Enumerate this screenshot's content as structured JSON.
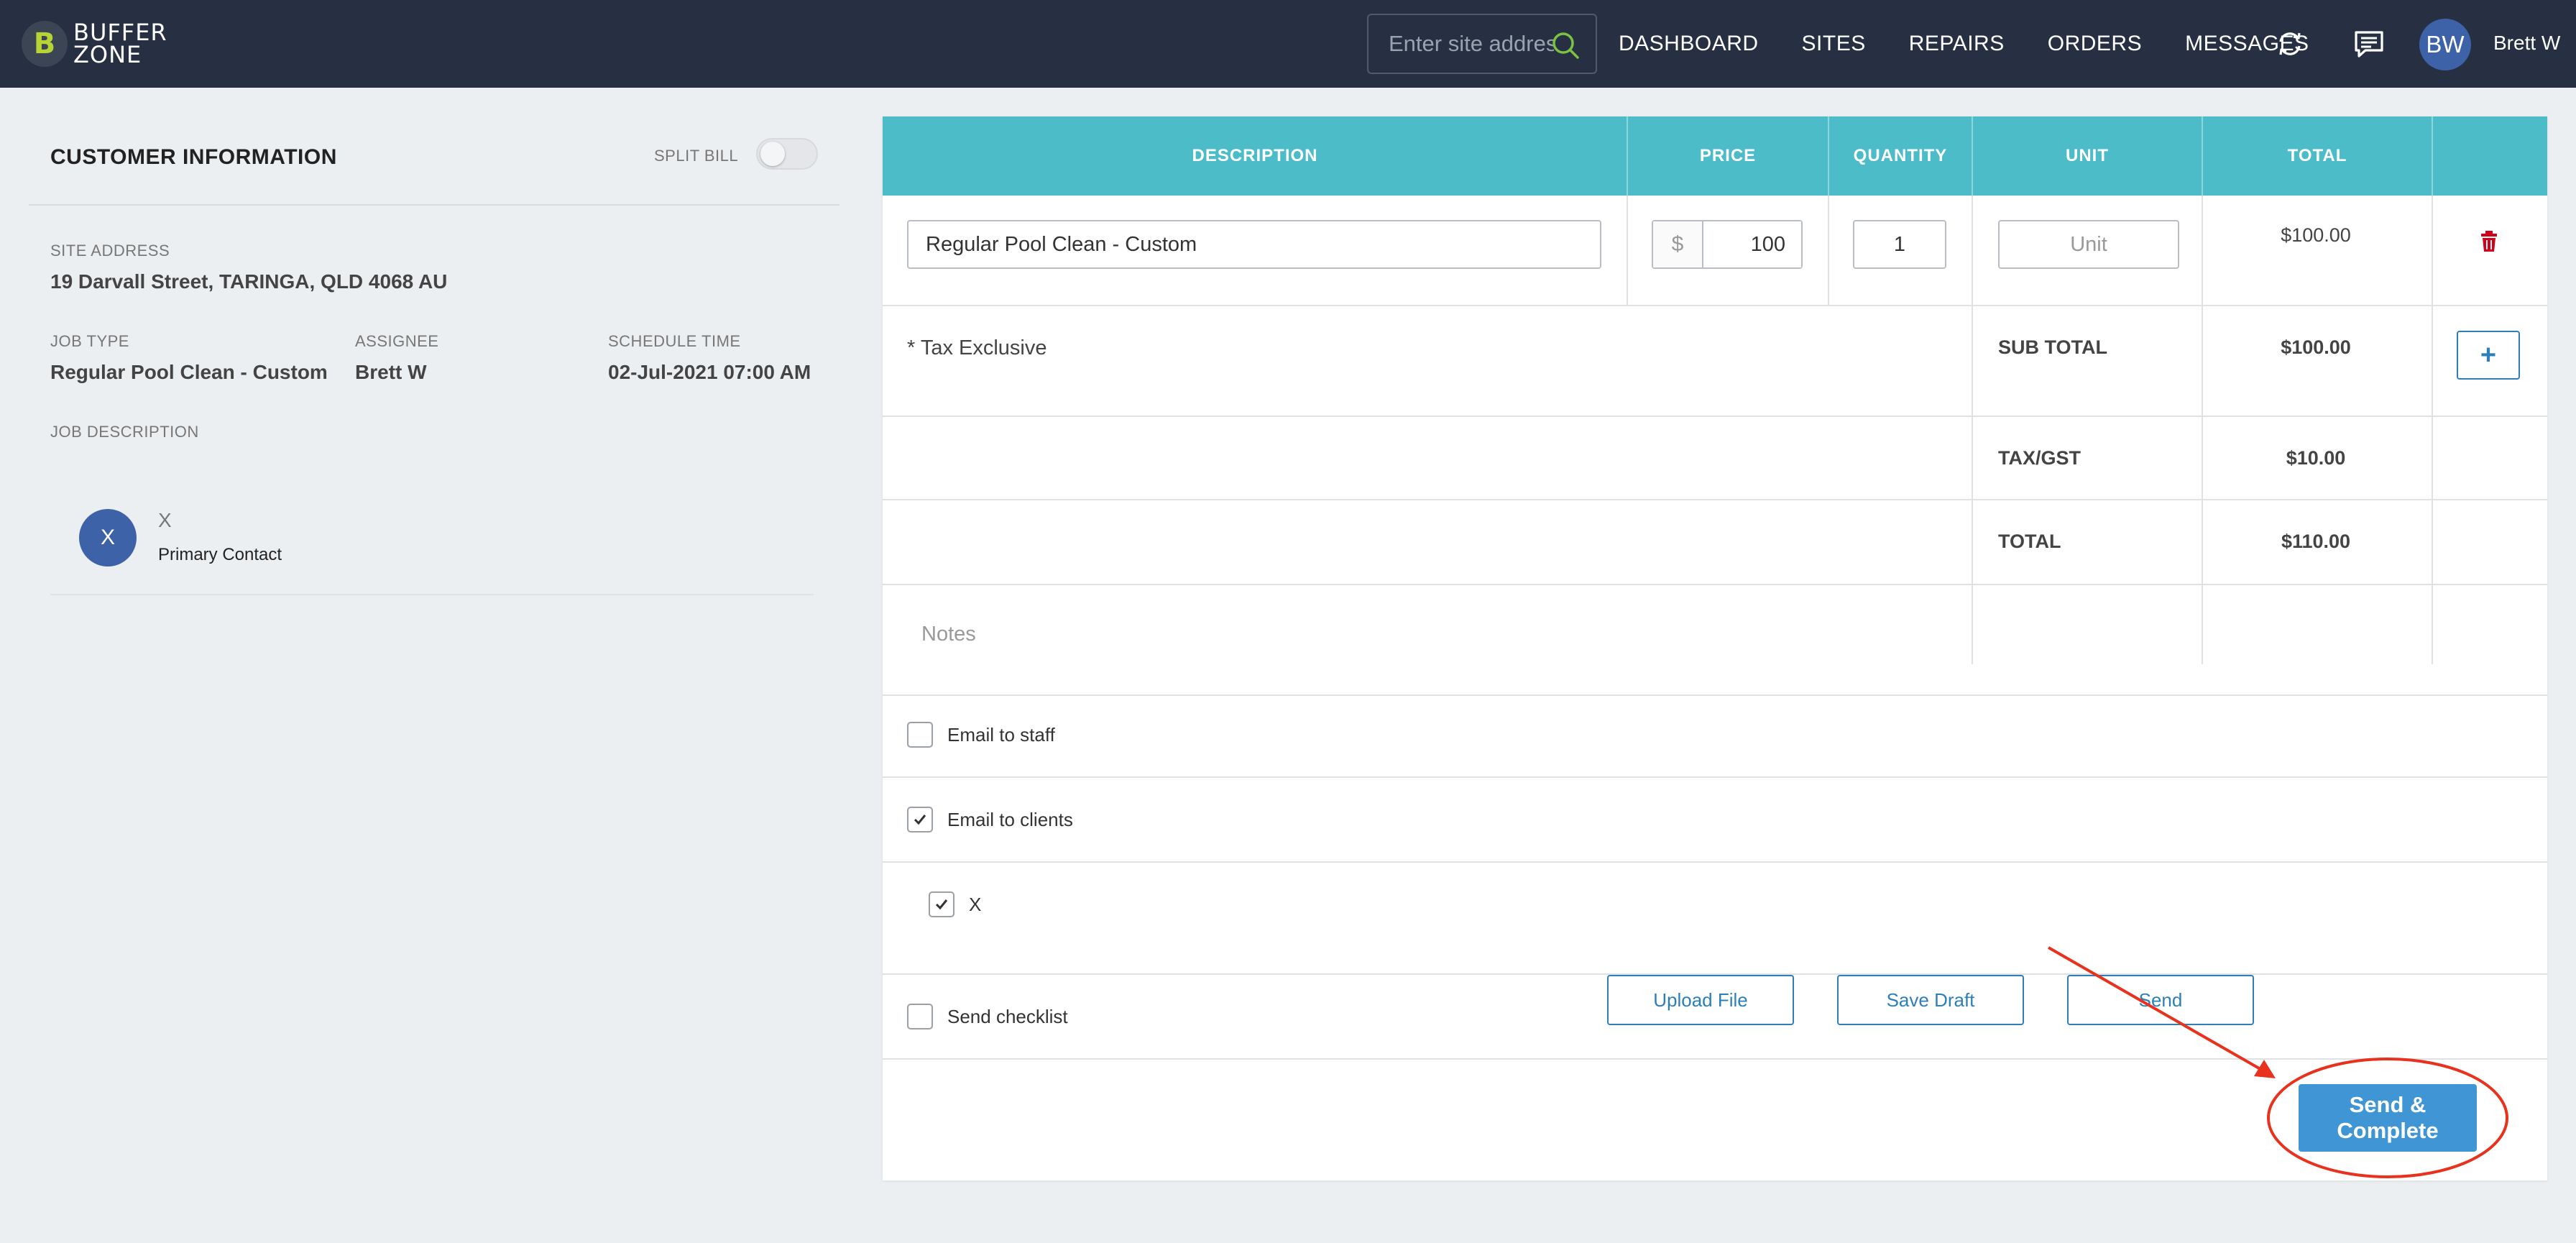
{
  "header": {
    "logo_letter": "B",
    "logo_line1": "BUFFER",
    "logo_line2": "ZONE",
    "search_placeholder": "Enter site address",
    "nav": [
      "DASHBOARD",
      "SITES",
      "REPAIRS",
      "ORDERS",
      "MESSAGES"
    ],
    "user_initials": "BW",
    "user_name": "Brett W"
  },
  "customer": {
    "title": "CUSTOMER INFORMATION",
    "split_bill_label": "SPLIT BILL",
    "split_bill_on": false,
    "site_address_label": "SITE ADDRESS",
    "site_address": "19 Darvall Street, TARINGA, QLD 4068 AU",
    "job_type_label": "JOB TYPE",
    "job_type": "Regular Pool Clean - Custom",
    "assignee_label": "ASSIGNEE",
    "assignee": "Brett W",
    "schedule_label": "SCHEDULE TIME",
    "schedule": "02-Jul-2021 07:00 AM",
    "job_description_label": "JOB DESCRIPTION",
    "contact_initial": "X",
    "contact_name": "X",
    "contact_role": "Primary Contact"
  },
  "invoice": {
    "columns": [
      "DESCRIPTION",
      "PRICE",
      "QUANTITY",
      "UNIT",
      "TOTAL"
    ],
    "item": {
      "description": "Regular Pool Clean - Custom",
      "currency_symbol": "$",
      "price": "100",
      "quantity": "1",
      "unit_placeholder": "Unit",
      "total": "$100.00"
    },
    "tax_note": "* Tax Exclusive",
    "subtotal_label": "SUB TOTAL",
    "subtotal": "$100.00",
    "tax_label": "TAX/GST",
    "tax": "$10.00",
    "total_label": "TOTAL",
    "total": "$110.00",
    "add_symbol": "+",
    "notes_placeholder": "Notes"
  },
  "options": {
    "email_staff": {
      "label": "Email to staff",
      "checked": false
    },
    "email_clients": {
      "label": "Email to clients",
      "checked": true
    },
    "client_x": {
      "label": "X",
      "checked": true
    },
    "send_checklist": {
      "label": "Send checklist",
      "checked": false
    }
  },
  "actions": {
    "upload": "Upload File",
    "save_draft": "Save Draft",
    "send": "Send",
    "send_complete": "Send & Complete"
  },
  "colors": {
    "topbar": "#263042",
    "table_header": "#4dbcc9",
    "primary": "#4096d4",
    "accent_annotation": "#e8321e"
  }
}
